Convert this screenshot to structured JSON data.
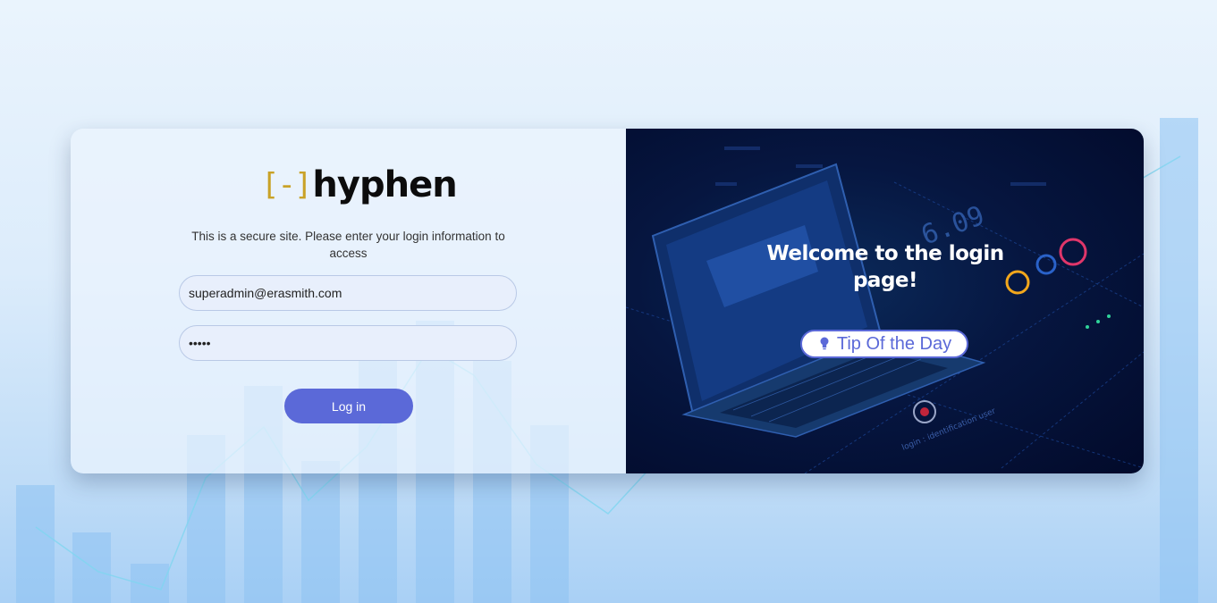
{
  "brand": {
    "mark": "[-]",
    "name": "hyphen",
    "mark_color": "#c9a227"
  },
  "login": {
    "intro": "This is a secure site. Please enter your login information to access",
    "email_value": "superadmin@erasmith.com",
    "password_value": "12345",
    "button_label": "Log in",
    "accent": "#5b69d8"
  },
  "promo": {
    "welcome": "Welcome to the login page!",
    "tip_label": "Tip Of the Day",
    "tip_icon": "lightbulb-icon",
    "illustration_texts": [
      "6.09",
      "login : identification user"
    ]
  }
}
